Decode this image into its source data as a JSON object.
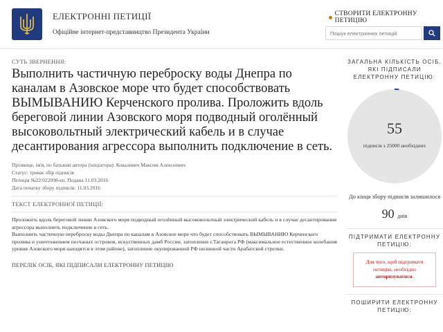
{
  "header": {
    "title": "ЕЛЕКТРОННІ ПЕТИЦІЇ",
    "subtitle": "Офіційне інтернет-представництво Президента України",
    "create_label": "СТВОРИТИ ЕЛЕКТРОННУ ПЕТИЦІЮ",
    "search_placeholder": "Пошук електронних петицій"
  },
  "petition": {
    "section_label": "СУТЬ ЗВЕРНЕННЯ:",
    "title": "Выполнить частичную переброску воды Днепра по каналам в Азовское море что будет способствовать ВЫМЫВАНИЮ Керченского пролива. Проложить вдоль береговой линии Азовского моря подводный оголённый высоковольтный электрический кабель и в случае десантирования агрессора выполнить подключение в сеть.",
    "author": "Прізвище, ім'я, по батькові автора (ініціатора): Ковалевич Максим Алексеевич",
    "status": "Статус: триває збір підписів",
    "number": "Петиція №22/022098-еп. Подана 11.03.2016",
    "start_date": "Дата початку збору підписів: 11.03.2016",
    "text_label": "ТЕКСТ ЕЛЕКТРОННОЇ ПЕТИЦІЇ:",
    "text_p1": "Проложить вдоль береговой линии Азовского моря подводный оголённый высоковольтный электрический кабель и в случае десантирования агрессора выполнить подключение в сеть.",
    "text_p2": "Выполнить частичную переброску воды Днепра по каналам в Азовское море что будет способствовать ВЫМЫВАНИЮ Керченского пролива и уничтожением песчаных островов, искуственных дамб России, затопление г.Таганрога РФ (максимальное естественное колебания уровня Азовского моря находятся в этом районе), затопление окупированной РФ низинной части Арабатской стрелки.",
    "signers_link": "ПЕРЕЛІК ОСІБ, ЯКІ ПІДПИСАЛИ ЕЛЕКТРОННУ ПЕТИЦІЮ"
  },
  "sidebar": {
    "total_label": "ЗАГАЛЬНА КІЛЬКІСТЬ ОСІБ, ЯКІ ПІДПИСАЛИ ЕЛЕКТРОННУ ПЕТИЦІЮ:",
    "count": "55",
    "needed": "підписів з 25000 необхідних",
    "progress_fraction": 0.0022,
    "days_label": "До кінця збору підписів залишилося",
    "days": "90",
    "days_unit": "днів",
    "support_label": "ПІДТРИМАТИ ЕЛЕКТРОННУ ПЕТИЦІЮ:",
    "auth_text": "Для того, щоб підтримати петицію, необхідно",
    "auth_link": "авторизуватися",
    "share_label": "ПОШИРИТИ ЕЛЕКТРОННУ ПЕТИЦІЮ:"
  },
  "colors": {
    "brand": "#1f3a7d",
    "accent": "#b8860b",
    "progress": "#2b3f8f",
    "donut": "#e5e5e5",
    "alert": "#b22222"
  }
}
